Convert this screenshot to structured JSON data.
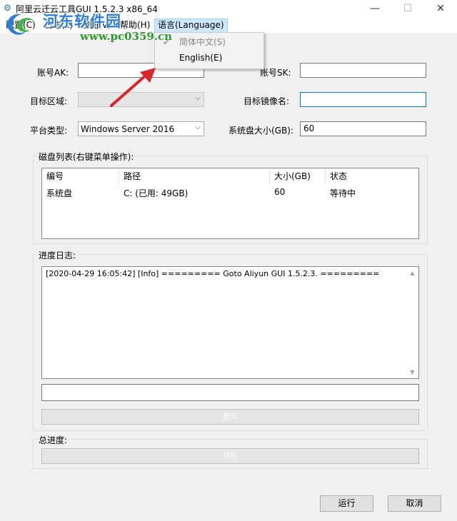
{
  "window": {
    "title": "阿里云迁云工具GUI 1.5.2.3 x86_64",
    "app_icon": "app-icon",
    "minimize_glyph": "—",
    "maximize_glyph": "☐",
    "close_glyph": "✕"
  },
  "watermark": {
    "title": "河东软件园",
    "url": "www.pc0359.cn"
  },
  "menu": {
    "items": [
      {
        "label": "配置(C)"
      },
      {
        "label": "日志(L)"
      },
      {
        "label": "视图(V)"
      },
      {
        "label": "帮助(H)"
      },
      {
        "label": "语言(Language)"
      }
    ],
    "dropdown": [
      {
        "label": "简体中文(S)",
        "checked": true,
        "enabled": false
      },
      {
        "label": "English(E)",
        "checked": false,
        "enabled": true
      }
    ]
  },
  "form": {
    "ak_label": "账号AK:",
    "ak_value": "",
    "sk_label": "账号SK:",
    "sk_value": "",
    "region_label": "目标区域:",
    "region_value": "",
    "image_name_label": "目标镜像名:",
    "image_name_value": "",
    "platform_label": "平台类型:",
    "platform_value": "Windows Server 2016",
    "sysdisk_label": "系统盘大小(GB):",
    "sysdisk_value": "60"
  },
  "disks": {
    "title": "磁盘列表(右键菜单操作):",
    "columns": [
      "编号",
      "路径",
      "大小(GB)",
      "状态"
    ],
    "rows": [
      [
        "系统盘",
        "C: (已用: 49GB)",
        "60",
        "等待中"
      ]
    ]
  },
  "log": {
    "title": "进度日志:",
    "lines": [
      "[2020-04-29 16:05:42] [Info]  ========= Goto Aliyun GUI 1.5.2.3. ========="
    ],
    "command_value": "",
    "progress_percent": 0,
    "progress_label": "0%"
  },
  "total": {
    "title": "总进度:",
    "progress_percent": 0,
    "progress_label": "0%"
  },
  "buttons": {
    "run": "运行",
    "cancel": "取消"
  },
  "colors": {
    "menu_highlight": "#cce8ff",
    "focus_border": "#0078d7",
    "arrow": "#d9262a",
    "watermark_blue": "#2b7fd4",
    "watermark_green": "#2f9a2f"
  }
}
